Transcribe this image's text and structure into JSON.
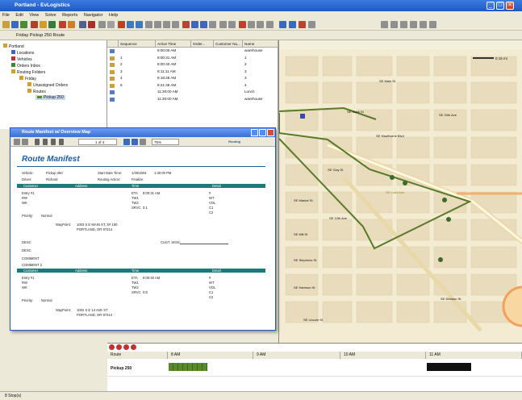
{
  "app": {
    "title": "Portland - EvLogistics",
    "route_label": "Friday Pickup 250 Route",
    "status": "8 Stop(s)"
  },
  "menu": [
    "File",
    "Edit",
    "View",
    "Solve",
    "Reports",
    "Navigator",
    "Help"
  ],
  "tree": {
    "items": [
      {
        "label": "Portland",
        "indent": 0
      },
      {
        "label": "Locations",
        "indent": 1
      },
      {
        "label": "Vehicles",
        "indent": 1
      },
      {
        "label": "Orders Inbox",
        "indent": 1
      },
      {
        "label": "Routing Folders",
        "indent": 1
      },
      {
        "label": "Friday",
        "indent": 2
      },
      {
        "label": "Unassigned Orders",
        "indent": 3
      },
      {
        "label": "Routes",
        "indent": 3
      },
      {
        "label": "Pickup 250",
        "indent": 4
      }
    ]
  },
  "grid": {
    "columns": [
      "Sequence",
      "Arrive Time",
      "Order...",
      "Customer Nu...",
      "Name"
    ],
    "rows": [
      [
        "",
        "8:00:00 AM",
        "",
        "",
        "warehouse"
      ],
      [
        "1",
        "8:00:31 AM",
        "",
        "",
        "1"
      ],
      [
        "2",
        "8:00:40 AM",
        "",
        "",
        "2"
      ],
      [
        "3",
        "8:11:11 AM",
        "",
        "",
        "3"
      ],
      [
        "4",
        "8:18:28 AM",
        "",
        "",
        "3"
      ],
      [
        "5",
        "8:21:48 AM",
        "",
        "",
        "4"
      ],
      [
        "",
        "11:30:00 AM",
        "",
        "",
        "Lunch"
      ],
      [
        "",
        "11:30:00 AM",
        "",
        "",
        "warehouse"
      ]
    ]
  },
  "manifest": {
    "window_title": "Route Manifest w/ Overview Map",
    "page_field": "1 of 4",
    "zoom": "75%",
    "brand": "Routing",
    "heading": "Route Manifest",
    "vehicle_label": "Vehicle:",
    "vehicle_value": "Pickup 250",
    "driver_label": "Driver:",
    "driver_value": "Richard",
    "start_label": "Start Date Time:",
    "start_value": "1/30/2004",
    "start_time": "1:30:00 PM",
    "routing_label": "Routing Action:",
    "routing_value": "Finalize",
    "table_headers": [
      "Customer",
      "Address",
      "Time",
      "Detail"
    ],
    "entry_label": "Entry #1",
    "rw_label": "RW",
    "wk_label": "WK",
    "eta_label": "ETA",
    "eta_value": "8:00:31 AM",
    "tw1_label": "TW1",
    "tw2_label": "TW2",
    "srvc_label": "SRVC",
    "srvc_value": "0:1",
    "hash_label": "#",
    "wt_label": "WT",
    "vol_label": "VOL",
    "c1_label": "C1",
    "c2_label": "C2",
    "priority_label": "Priority:",
    "priority_value": "Normal",
    "waypoints_label": "WayPoint:",
    "waypoints_line1": "1003 S E MAIN ST, S# 100",
    "waypoints_line2": "PORTLAND, OR 97214",
    "desc1": "DESC",
    "desc2": "DESC",
    "comment1": "COMMENT",
    "comment2": "COMMENT 2",
    "sig_label": "CUST. SIGN:",
    "eta2_value": "8:00:40 AM",
    "srvc2_value": "0:5",
    "waypoints2_line1": "1002 S E 14 AVE ST",
    "waypoints2_line2": "PORTLAND, OR 97214"
  },
  "map": {
    "scale_label": "0.15 mi",
    "streets": [
      "SE Main St",
      "SE Stark St",
      "SE Hawthorne Blvd",
      "SE Clay St",
      "SE Market St",
      "SE Mill St",
      "SE Stephens St",
      "SE Harrison St",
      "SE Lincoln St",
      "SE 12th Ave",
      "SE 20th Ave",
      "SE Ladd Ave",
      "SE Division St"
    ],
    "route_color": "#5a7a2a",
    "stop_color": "#3b6a2a"
  },
  "gantt": {
    "route_col": "Route",
    "times": [
      "9 AM",
      "10 AM",
      "11 AM"
    ],
    "first_time": "8 AM",
    "row_label": "Pickup 250",
    "bar_color": "#5a8a2a"
  }
}
